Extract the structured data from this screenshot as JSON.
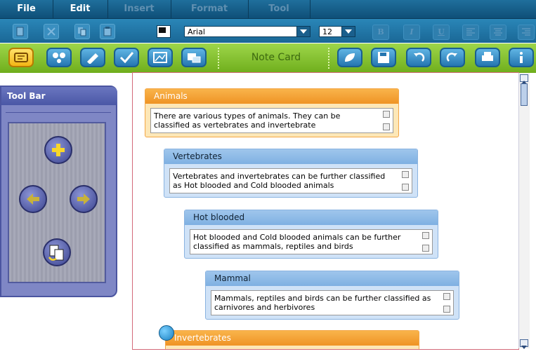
{
  "menubar": {
    "items": [
      {
        "label": "File",
        "enabled": true
      },
      {
        "label": "Edit",
        "enabled": true
      },
      {
        "label": "Insert",
        "enabled": false
      },
      {
        "label": "Format",
        "enabled": false
      },
      {
        "label": "Tool",
        "enabled": false
      }
    ]
  },
  "format_toolbar": {
    "font": "Arial",
    "font_size": "12",
    "style_buttons": [
      "B",
      "I",
      "U"
    ]
  },
  "main_toolbar": {
    "title": "Note Card"
  },
  "tool_panel": {
    "title": "Tool Bar"
  },
  "cards": [
    {
      "title": "Animals",
      "text": "There are various types of animals. They can be classified as vertebrates and invertebrate"
    },
    {
      "title": "Vertebrates",
      "text": "Vertebrates and invertebrates can be further classified as Hot blooded and Cold blooded animals"
    },
    {
      "title": "Hot blooded",
      "text": "Hot blooded and Cold blooded animals can be further classified as mammals, reptiles and birds"
    },
    {
      "title": "Mammal",
      "text": "Mammals, reptiles and birds can be further classified as carnivores and herbivores"
    },
    {
      "title": "Invertebrates",
      "text": ""
    }
  ],
  "colors": {
    "menubar": "#1f6f9c",
    "toolbar_green": "#8cc63f",
    "selected_button": "#f3b614",
    "orange_card": "#ef9325",
    "blue_card": "#7fb0e2",
    "panel": "#7f87c5"
  }
}
